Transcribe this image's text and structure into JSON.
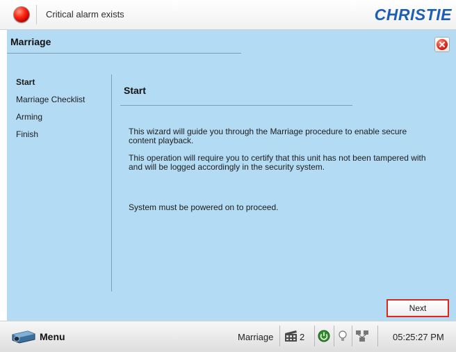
{
  "alarm": {
    "text": "Critical alarm exists",
    "color": "#e01c0b"
  },
  "brand": {
    "logo_text": "CHRISTIE",
    "color": "#1e5fb3"
  },
  "panel": {
    "title": "Marriage",
    "background": "#b3dcf4"
  },
  "wizard": {
    "steps": [
      {
        "label": "Start",
        "active": true
      },
      {
        "label": "Marriage Checklist",
        "active": false
      },
      {
        "label": "Arming",
        "active": false
      },
      {
        "label": "Finish",
        "active": false
      }
    ],
    "content_title": "Start",
    "paragraphs": [
      "This wizard will guide you through the Marriage procedure to enable secure content playback.",
      "This operation will require you to certify that this unit has not been tampered with and will be logged accordingly in the security system.",
      "System must be powered on to proceed."
    ],
    "next_label": "Next",
    "highlight_color": "#e0261b"
  },
  "statusbar": {
    "menu_label": "Menu",
    "mode_label": "Marriage",
    "channel_number": "2",
    "clock": "05:25:27 PM",
    "icons": [
      "projector-menu-icon",
      "film-channel-icon",
      "power-status-icon",
      "lamp-icon",
      "network-icon"
    ]
  }
}
